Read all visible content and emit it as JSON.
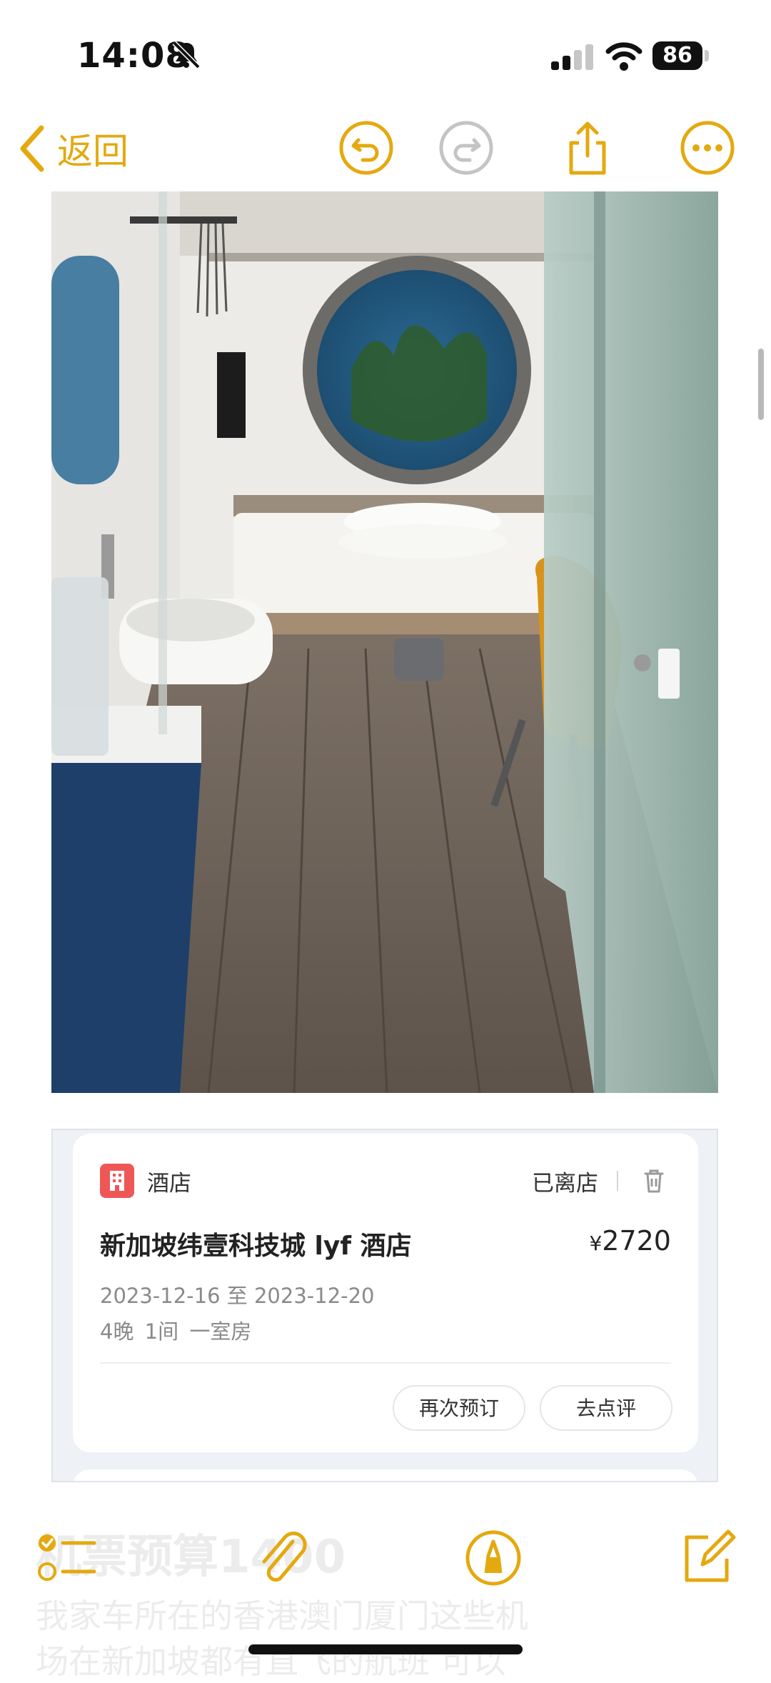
{
  "status_bar": {
    "time": "14:08",
    "battery": "86"
  },
  "nav": {
    "back_label": "返回"
  },
  "order_card": {
    "category": "酒店",
    "status": "已离店",
    "hotel_name": "新加坡纬壹科技城 lyf 酒店",
    "currency": "¥",
    "price": "2720",
    "dates": "2023-12-16 至 2023-12-20",
    "details": "4晚  1间  一室房",
    "rebook_label": "再次预订",
    "review_label": "去点评"
  },
  "note": {
    "heading": "机票预算1400",
    "line1": "我家车所在的香港澳门厦门这些机",
    "line2": "场在新加坡都有直飞的航班 可以"
  },
  "colors": {
    "accent": "#e4a90f",
    "hotel_icon": "#ef5757"
  }
}
